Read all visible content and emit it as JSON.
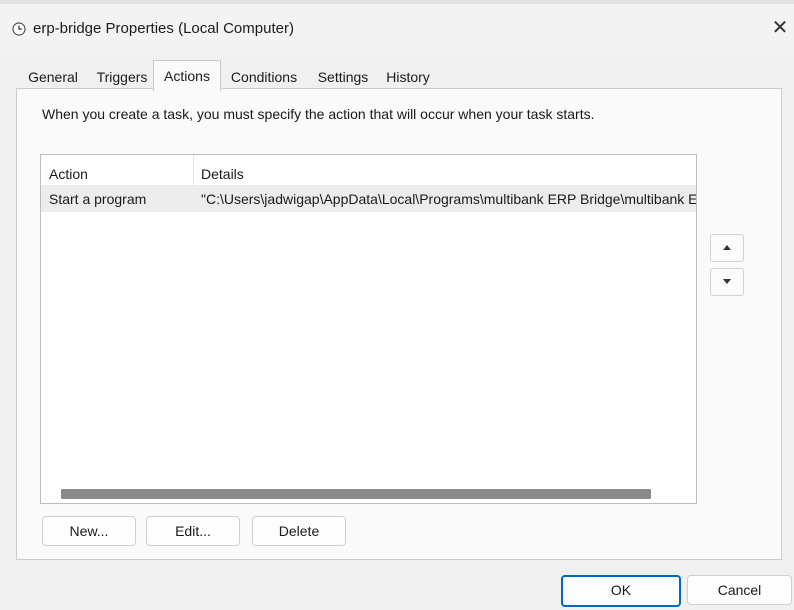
{
  "window": {
    "title": "erp-bridge Properties (Local Computer)",
    "close_glyph": "✕"
  },
  "tabs": [
    {
      "label": "General",
      "active": false
    },
    {
      "label": "Triggers",
      "active": false
    },
    {
      "label": "Actions",
      "active": true
    },
    {
      "label": "Conditions",
      "active": false
    },
    {
      "label": "Settings",
      "active": false
    },
    {
      "label": "History",
      "active": false
    }
  ],
  "actions_tab": {
    "instructions": "When you create a task, you must specify the action that will occur when your task starts.",
    "columns": [
      "Action",
      "Details"
    ],
    "rows": [
      {
        "action": "Start a program",
        "details": "\"C:\\Users\\jadwigap\\AppData\\Local\\Programs\\multibank ERP Bridge\\multibank ERP Bridge.exe\"",
        "selected": true
      }
    ],
    "buttons": {
      "new": "New...",
      "edit": "Edit...",
      "delete": "Delete"
    }
  },
  "dialog_buttons": {
    "ok": "OK",
    "cancel": "Cancel"
  },
  "icons": {
    "title": "clock-icon",
    "move_up": "triangle-up-icon",
    "move_down": "triangle-down-icon"
  },
  "colors": {
    "accent": "#0067c0",
    "selection": "#ececec",
    "scrollbar": "#8a8a8a"
  }
}
